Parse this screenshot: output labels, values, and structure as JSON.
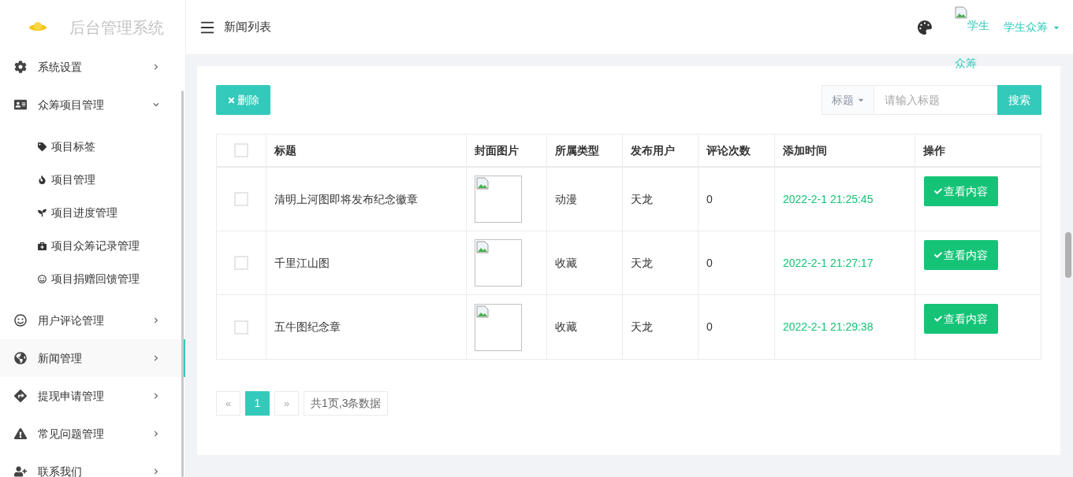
{
  "sidebar": {
    "brand": "后台管理系统",
    "items": [
      {
        "label": "系统设置",
        "expanded": false,
        "selected": false
      },
      {
        "label": "众筹项目管理",
        "expanded": true,
        "selected": false,
        "children": [
          {
            "label": "项目标签"
          },
          {
            "label": "项目管理"
          },
          {
            "label": "项目进度管理"
          },
          {
            "label": "项目众筹记录管理"
          },
          {
            "label": "项目捐赠回馈管理"
          }
        ]
      },
      {
        "label": "用户评论管理",
        "expanded": false,
        "selected": false
      },
      {
        "label": "新闻管理",
        "expanded": false,
        "selected": true
      },
      {
        "label": "提现申请管理",
        "expanded": false,
        "selected": false
      },
      {
        "label": "常见问题管理",
        "expanded": false,
        "selected": false
      },
      {
        "label": "联系我们",
        "expanded": false,
        "selected": false
      }
    ]
  },
  "header": {
    "page_title": "新闻列表",
    "avatar_alt": "学生众筹",
    "user": "学生众筹"
  },
  "toolbar": {
    "delete": "删除",
    "search_field": "标题",
    "search_placeholder": "请输入标题",
    "search": "搜索"
  },
  "table": {
    "select_all_checked": false,
    "columns": [
      "标题",
      "封面图片",
      "所属类型",
      "发布用户",
      "评论次数",
      "添加时间",
      "操作"
    ],
    "rows": [
      {
        "checked": false,
        "title": "清明上河图即将发布纪念徽章",
        "type": "动漫",
        "user": "天龙",
        "comments": "0",
        "added": "2022-2-1 21:25:45",
        "action": "查看内容"
      },
      {
        "checked": false,
        "title": "千里江山图",
        "type": "收藏",
        "user": "天龙",
        "comments": "0",
        "added": "2022-2-1 21:27:17",
        "action": "查看内容"
      },
      {
        "checked": false,
        "title": "五牛图纪念章",
        "type": "收藏",
        "user": "天龙",
        "comments": "0",
        "added": "2022-2-1 21:29:38",
        "action": "查看内容"
      }
    ]
  },
  "pagination": {
    "prev": "«",
    "pages": [
      {
        "label": "1",
        "selected": true
      }
    ],
    "next": "»",
    "summary": "共1页,3条数据"
  }
}
